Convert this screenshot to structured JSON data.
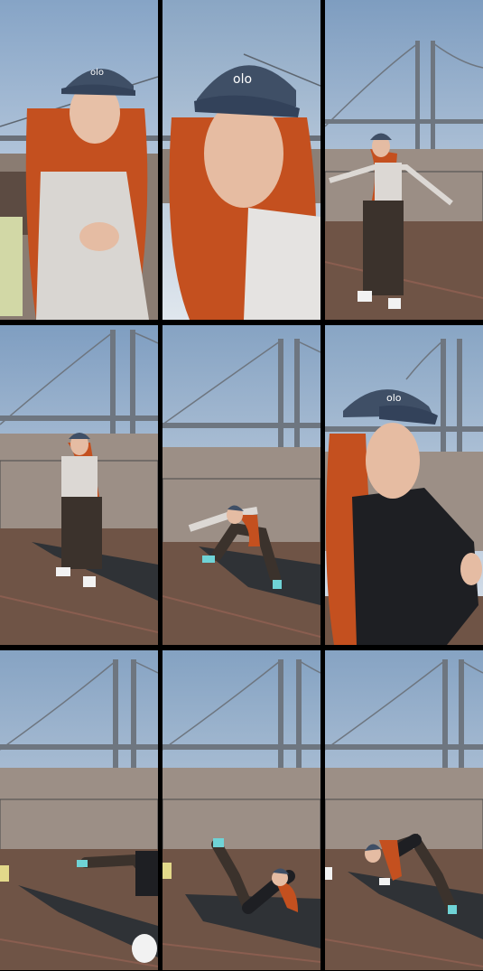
{
  "collage": {
    "layout": "3x3 grid",
    "frames": [
      {
        "id": 1,
        "scene": "closeup",
        "cap_logo": "olo"
      },
      {
        "id": 2,
        "scene": "closeup-large",
        "cap_logo": "olo"
      },
      {
        "id": 3,
        "scene": "standing-arms-out"
      },
      {
        "id": 4,
        "scene": "standing-mat"
      },
      {
        "id": 5,
        "scene": "lunge-mat"
      },
      {
        "id": 6,
        "scene": "closeup-black-jacket",
        "cap_logo": "olo"
      },
      {
        "id": 7,
        "scene": "lying-side-mat"
      },
      {
        "id": 8,
        "scene": "leg-raise-mat"
      },
      {
        "id": 9,
        "scene": "bent-over-mat"
      }
    ]
  },
  "colors": {
    "sky_top": "#8ea9c7",
    "sky_bottom": "#dfe6ec",
    "hair": "#c4501f",
    "cap": "#3f4f66",
    "deck": "#6f5446",
    "mat": "#2f3236",
    "bridge": "#6e7680"
  }
}
